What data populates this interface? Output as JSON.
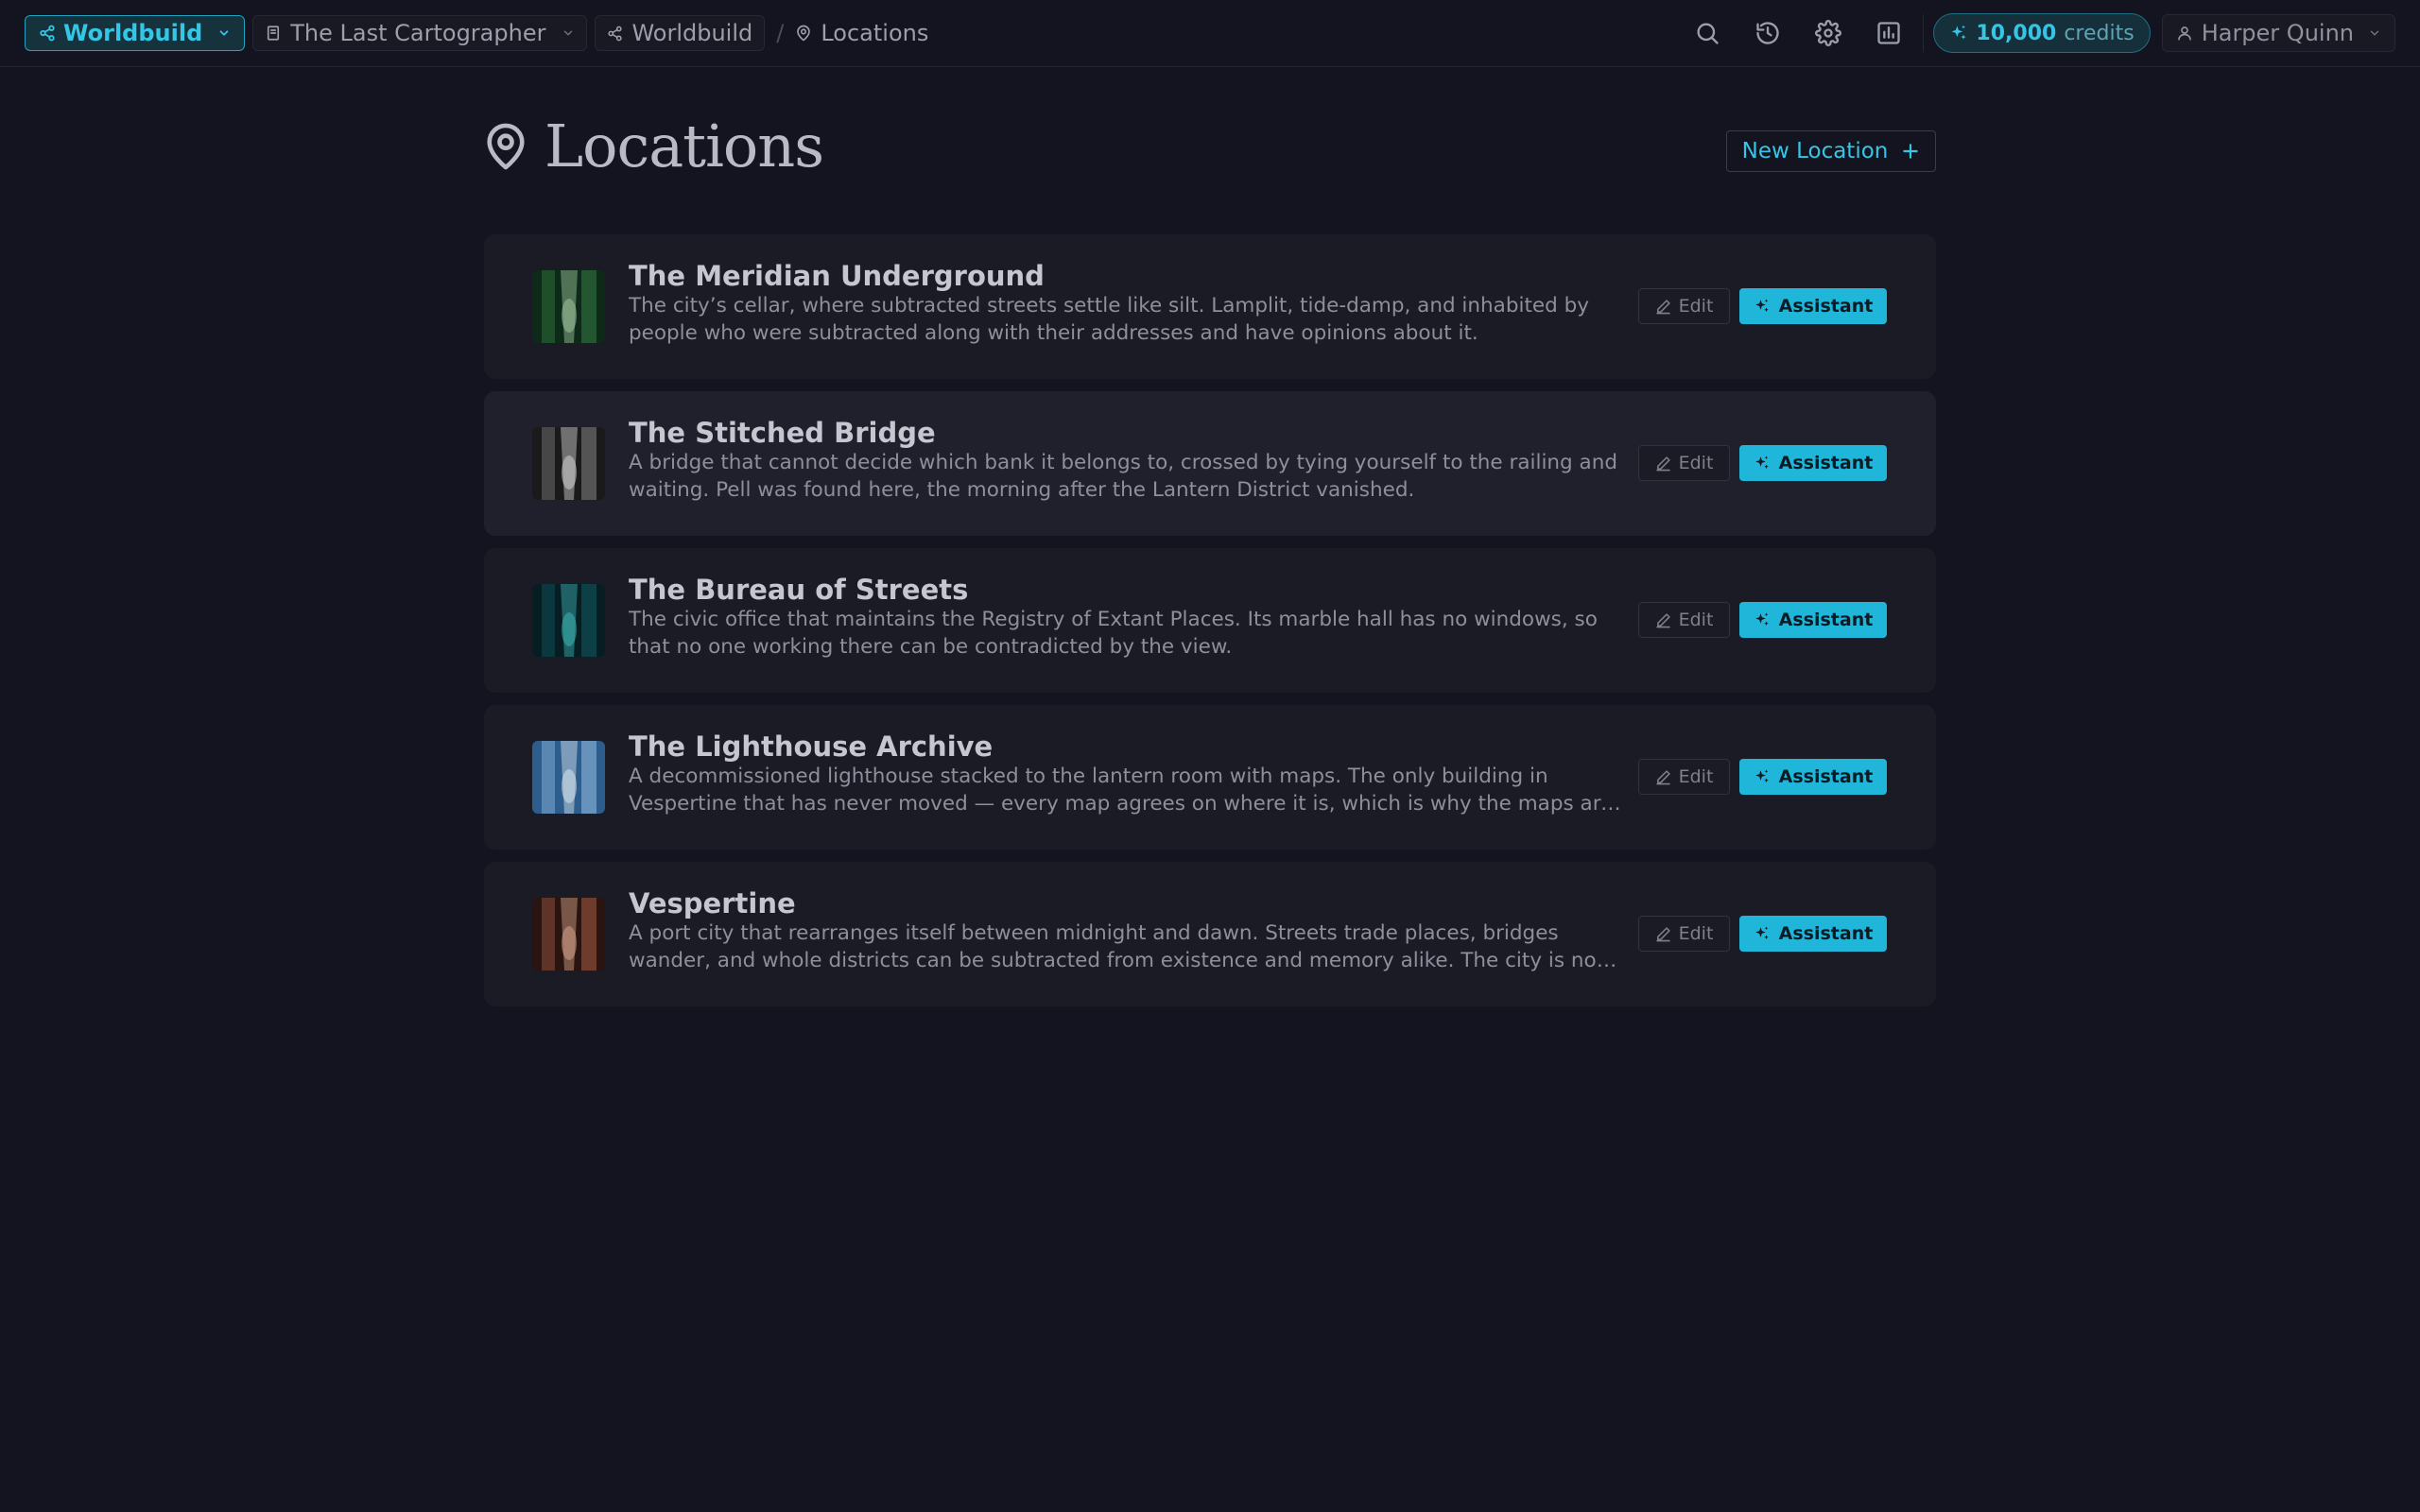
{
  "topbar": {
    "mode_label": "Worldbuild",
    "project_label": "The Last Cartographer",
    "breadcrumb": [
      "Worldbuild",
      "Locations"
    ],
    "credits_amount": "10,000",
    "credits_label": "credits",
    "user_name": "Harper Quinn"
  },
  "page": {
    "title": "Locations",
    "new_button_label": "New Location"
  },
  "card_actions": {
    "edit_label": "Edit",
    "assistant_label": "Assistant"
  },
  "locations": [
    {
      "name": "The Meridian Underground",
      "description": "The city’s cellar, where subtracted streets settle like silt. Lamplit, tide-damp, and inhabited by people who were subtracted along with their addresses and have opinions about it.",
      "thumb_colors": [
        "#0d2a18",
        "#2f6b3c",
        "#a7c9a4"
      ]
    },
    {
      "name": "The Stitched Bridge",
      "description": "A bridge that cannot decide which bank it belongs to, crossed by tying yourself to the railing and waiting. Pell was found here, the morning after the Lantern District vanished.",
      "thumb_colors": [
        "#1a1a1a",
        "#6d6d6d",
        "#d9d9d9"
      ]
    },
    {
      "name": "The Bureau of Streets",
      "description": "The civic office that maintains the Registry of Extant Places. Its marble hall has no windows, so that no one working there can be contradicted by the view.",
      "thumb_colors": [
        "#061d22",
        "#0f4f55",
        "#3fb9b8"
      ]
    },
    {
      "name": "The Lighthouse Archive",
      "description": "A decommissioned lighthouse stacked to the lantern room with maps. The only building in Vespertine that has never moved — every map agrees on where it is, which is why the maps are kept here.",
      "thumb_colors": [
        "#2d5d8c",
        "#7fa9cf",
        "#dfe9f1"
      ]
    },
    {
      "name": "Vespertine",
      "description": "A port city that rearranges itself between midnight and dawn. Streets trade places, bridges wander, and whole districts can be subtracted from existence and memory alike. The city is not hostile, only restless.",
      "thumb_colors": [
        "#2a1410",
        "#8a4d3b",
        "#d9a88e"
      ]
    }
  ]
}
